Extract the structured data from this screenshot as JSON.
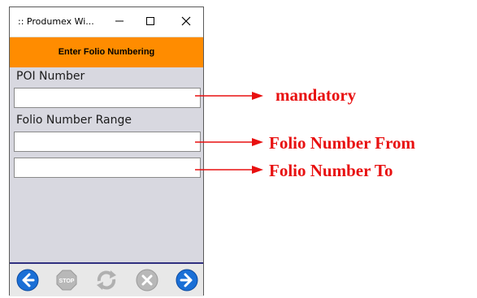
{
  "window": {
    "title": ":: Produmex Wi...",
    "minimize_symbol": "—",
    "maximize_symbol": "☐",
    "close_symbol": "✕"
  },
  "header": {
    "title": "Enter Folio Numbering"
  },
  "form": {
    "poi_label": "POI Number",
    "poi_value": "",
    "range_label": "Folio Number Range",
    "from_value": "",
    "to_value": ""
  },
  "toolbar": {
    "icons": [
      "arrow-left-icon",
      "stop-icon",
      "refresh-icon",
      "cancel-icon",
      "arrow-right-icon"
    ],
    "stop_text": "STOP"
  },
  "annotations": {
    "poi": "mandatory",
    "from": "Folio Number From",
    "to": "Folio Number To"
  },
  "colors": {
    "header_bg": "#ff8c00",
    "nav_blue": "#1a6fd6",
    "annotation_red": "#e81010",
    "disabled_gray": "#b0b0b0"
  }
}
